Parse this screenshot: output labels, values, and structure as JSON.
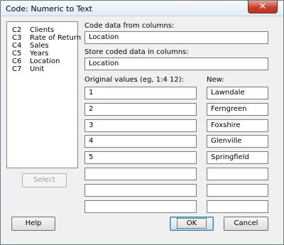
{
  "window": {
    "title": "Code: Numeric to Text",
    "close_glyph": "✕"
  },
  "column_list": [
    {
      "col": "C2",
      "name": "Clients"
    },
    {
      "col": "C3",
      "name": "Rate of Return"
    },
    {
      "col": "C4",
      "name": "Sales"
    },
    {
      "col": "C5",
      "name": "Years"
    },
    {
      "col": "C6",
      "name": "Location"
    },
    {
      "col": "C7",
      "name": "Unit"
    }
  ],
  "code_from": {
    "label": "Code data from columns:",
    "value": "Location"
  },
  "store_in": {
    "label": "Store coded data in columns:",
    "value": "Location"
  },
  "original_header": "Original values (eg,  1:4  12):",
  "new_header": "New:",
  "rows": [
    {
      "original": "1",
      "new": "Lawndale"
    },
    {
      "original": "2",
      "new": "Ferngreen"
    },
    {
      "original": "3",
      "new": "Foxshire"
    },
    {
      "original": "4",
      "new": "Glenville"
    },
    {
      "original": "5",
      "new": "Springfield"
    },
    {
      "original": "",
      "new": ""
    },
    {
      "original": "",
      "new": ""
    },
    {
      "original": "",
      "new": ""
    }
  ],
  "buttons": {
    "select": "Select",
    "help": "Help",
    "ok": "OK",
    "cancel": "Cancel"
  }
}
